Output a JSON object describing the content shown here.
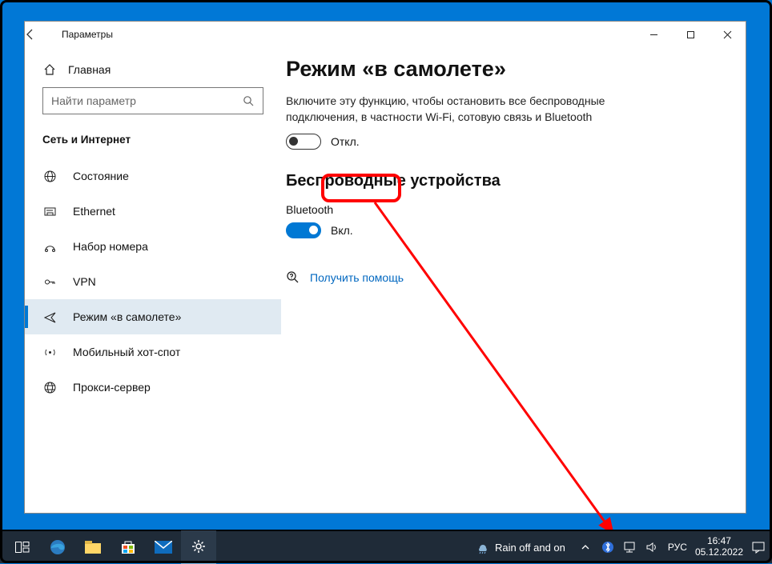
{
  "window": {
    "title": "Параметры",
    "controls": {
      "min": "—",
      "max": "▢",
      "close": "✕"
    }
  },
  "sidebar": {
    "home": "Главная",
    "search_placeholder": "Найти параметр",
    "section": "Сеть и Интернет",
    "items": [
      {
        "label": "Состояние",
        "icon": "globe-icon"
      },
      {
        "label": "Ethernet",
        "icon": "ethernet-icon"
      },
      {
        "label": "Набор номера",
        "icon": "dialup-icon"
      },
      {
        "label": "VPN",
        "icon": "vpn-icon"
      },
      {
        "label": "Режим «в самолете»",
        "icon": "airplane-icon",
        "selected": true
      },
      {
        "label": "Мобильный хот-спот",
        "icon": "hotspot-icon"
      },
      {
        "label": "Прокси-сервер",
        "icon": "proxy-icon"
      }
    ]
  },
  "content": {
    "heading": "Режим «в самолете»",
    "description": "Включите эту функцию, чтобы остановить все беспроводные подключения, в частности Wi-Fi, сотовую связь и Bluetooth",
    "airplane_toggle_label": "Откл.",
    "section2": "Беспроводные устройства",
    "bluetooth_label": "Bluetooth",
    "bluetooth_toggle_label": "Вкл.",
    "help_link": "Получить помощь"
  },
  "taskbar": {
    "weather": "Rain off and on",
    "lang": "РУС",
    "time": "16:47",
    "date": "05.12.2022"
  }
}
